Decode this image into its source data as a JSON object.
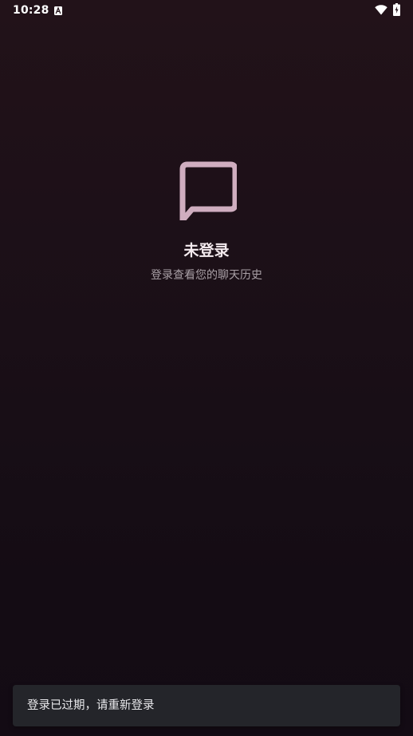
{
  "status_bar": {
    "time": "10:28",
    "notification_icon": "a-icon",
    "wifi_icon": "wifi-icon",
    "battery_icon": "battery-charging-icon"
  },
  "empty_state": {
    "icon": "chat-bubble-icon",
    "title": "未登录",
    "subtitle": "登录查看您的聊天历史"
  },
  "snackbar": {
    "message": "登录已过期，请重新登录"
  },
  "colors": {
    "icon_tint": "#cfadbf",
    "background_top": "#221219",
    "background_bottom": "#130b14",
    "snackbar_bg": "#24252a"
  }
}
